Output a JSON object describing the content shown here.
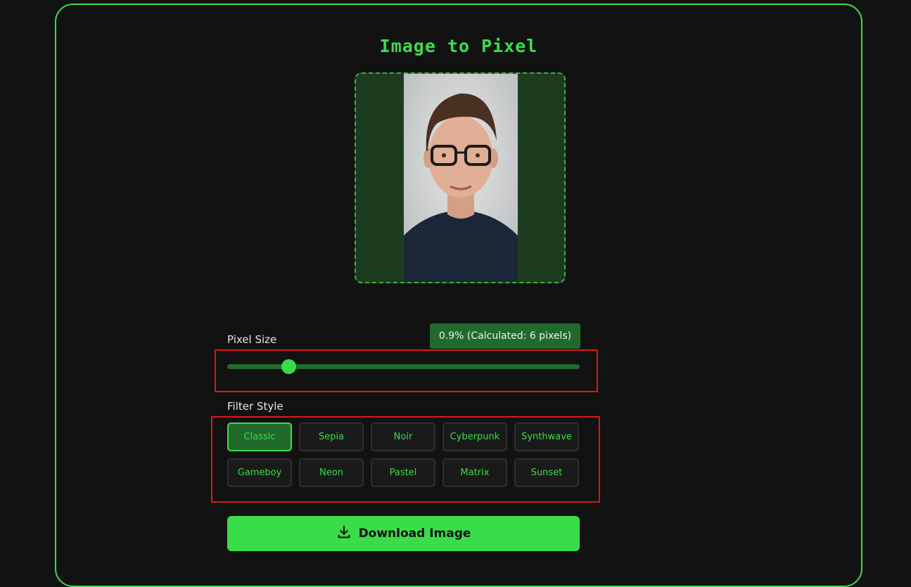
{
  "app": {
    "title": "Image to Pixel"
  },
  "preview": {
    "icon": "person-photo"
  },
  "pixel_size": {
    "label": "Pixel Size",
    "value_text": "0.9% (Calculated: 6 pixels)",
    "slider_fraction": 0.175
  },
  "filter_style": {
    "label": "Filter Style",
    "options": [
      "Classic",
      "Sepia",
      "Noir",
      "Cyberpunk",
      "Synthwave",
      "Gameboy",
      "Neon",
      "Pastel",
      "Matrix",
      "Sunset"
    ],
    "selected": "Classic"
  },
  "download": {
    "label": "Download Image",
    "icon": "download-icon"
  },
  "colors": {
    "accent": "#3bdc4a",
    "dark_accent": "#226a2c",
    "background": "#121212",
    "annotation": "#e01616"
  }
}
